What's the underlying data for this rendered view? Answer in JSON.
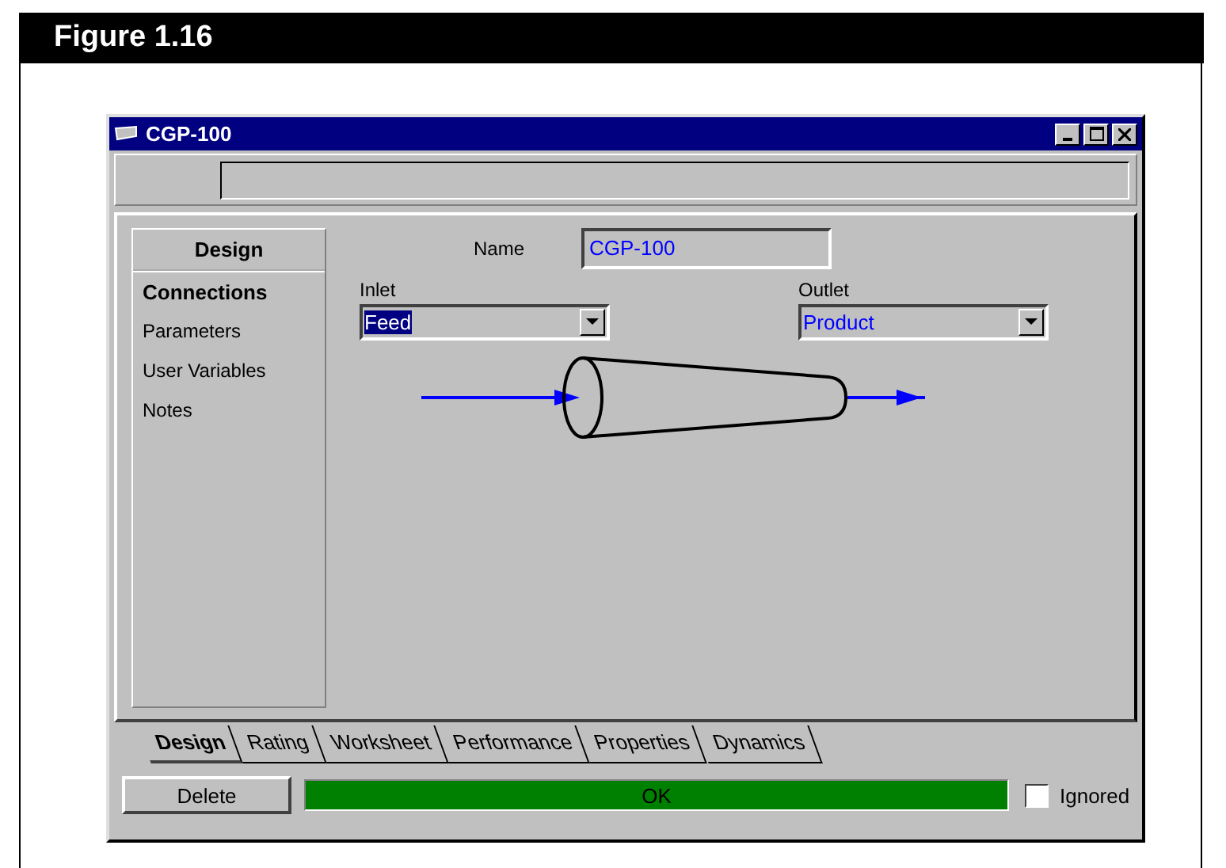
{
  "figure": {
    "title": "Figure 1.16"
  },
  "window": {
    "title": "CGP-100"
  },
  "sidebar": {
    "header": "Design",
    "items": [
      {
        "label": "Connections",
        "selected": true
      },
      {
        "label": "Parameters",
        "selected": false
      },
      {
        "label": "User Variables",
        "selected": false
      },
      {
        "label": "Notes",
        "selected": false
      }
    ]
  },
  "name_field": {
    "label": "Name",
    "value": "CGP-100"
  },
  "inlet": {
    "label": "Inlet",
    "value": "Feed",
    "highlighted": true
  },
  "outlet": {
    "label": "Outlet",
    "value": "Product",
    "highlighted": false
  },
  "tabs": [
    {
      "label": "Design",
      "selected": true
    },
    {
      "label": "Rating",
      "selected": false
    },
    {
      "label": "Worksheet",
      "selected": false
    },
    {
      "label": "Performance",
      "selected": false
    },
    {
      "label": "Properties",
      "selected": false
    },
    {
      "label": "Dynamics",
      "selected": false
    }
  ],
  "delete_button": "Delete",
  "status": {
    "text": "OK",
    "level": 1
  },
  "ignored": {
    "label": "Ignored",
    "checked": false
  }
}
